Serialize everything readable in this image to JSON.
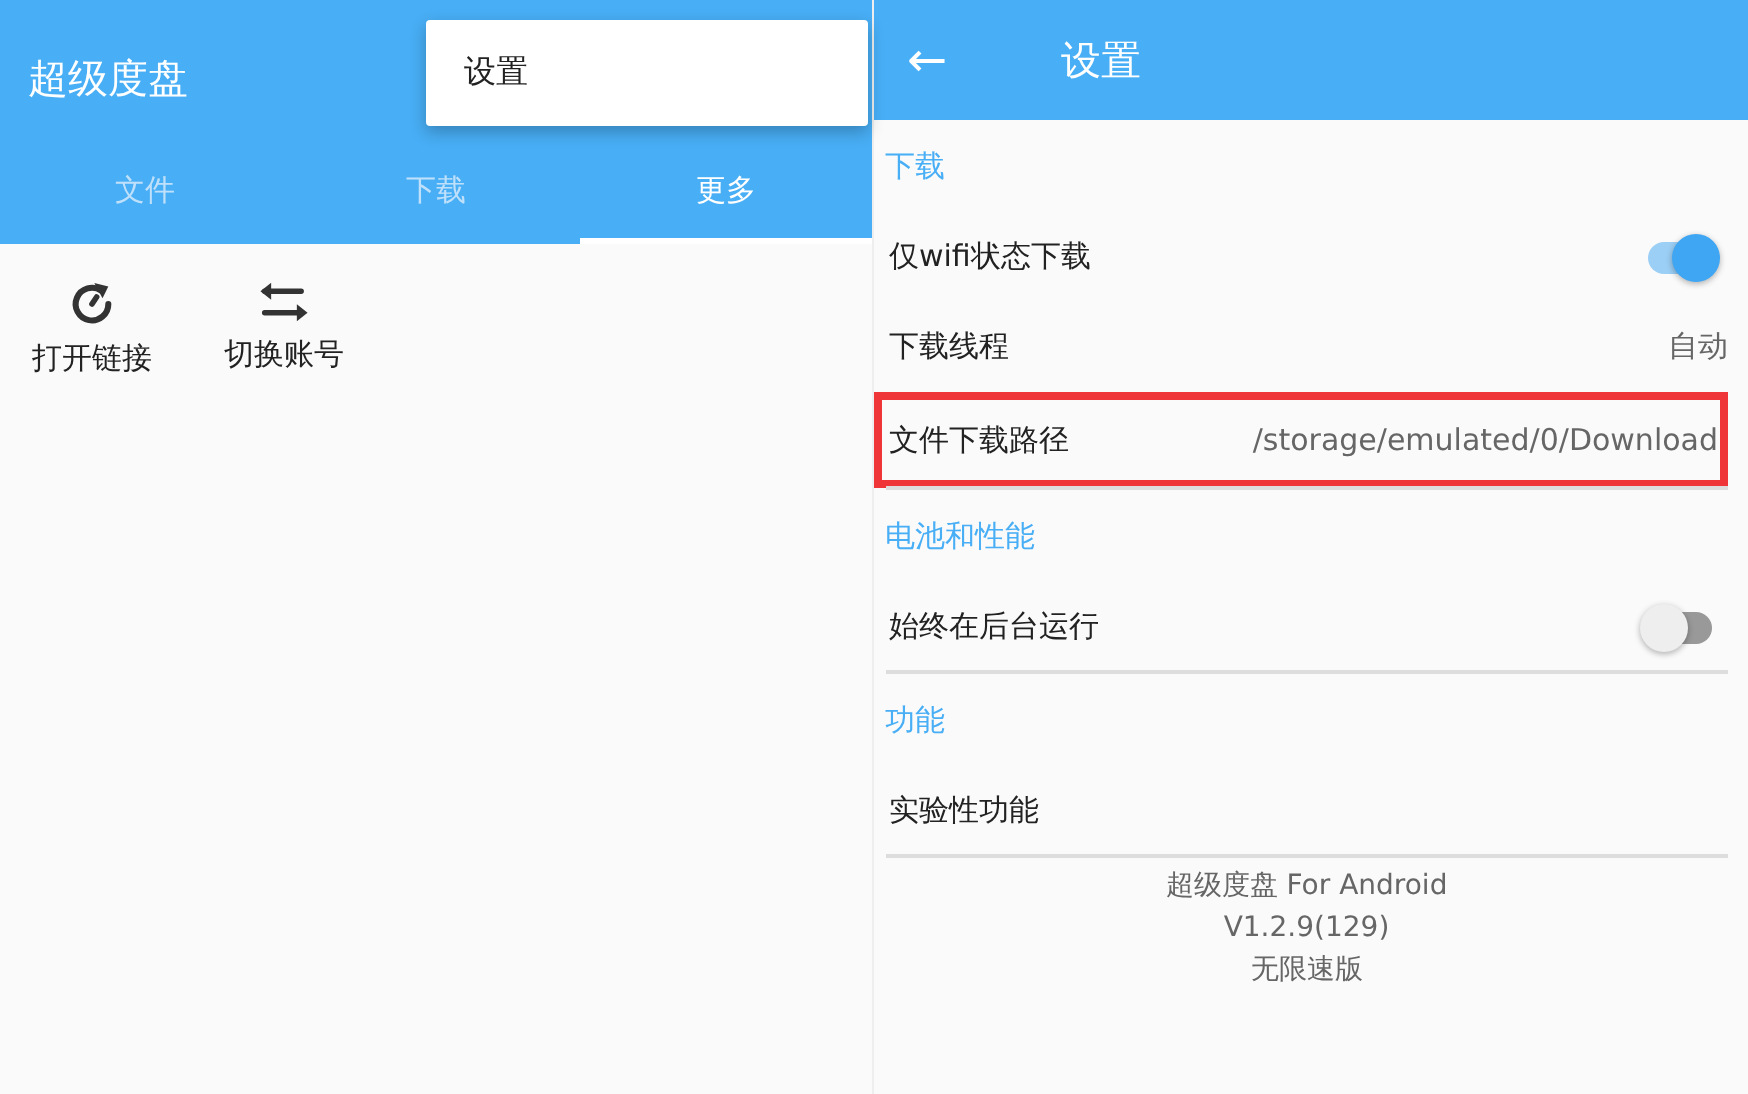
{
  "left": {
    "app_title": "超级度盘",
    "tabs": [
      {
        "label": "文件",
        "selected": false
      },
      {
        "label": "下载",
        "selected": false
      },
      {
        "label": "更多",
        "selected": true
      }
    ],
    "menu": {
      "items": [
        "设置"
      ]
    },
    "actions": [
      {
        "kind": "refresh",
        "label": "打开链接"
      },
      {
        "kind": "swap",
        "label": "切换账号"
      }
    ]
  },
  "right": {
    "back": "←",
    "title": "设置",
    "sections": [
      {
        "title": "下载",
        "rows": [
          {
            "kind": "toggle",
            "label": "仅wifi状态下载",
            "on": true,
            "highlighted": false
          },
          {
            "kind": "value",
            "label": "下载线程",
            "value": "自动",
            "highlighted": false
          },
          {
            "kind": "value",
            "label": "文件下载路径",
            "value": "/storage/emulated/0/Download",
            "highlighted": true
          }
        ]
      },
      {
        "title": "电池和性能",
        "rows": [
          {
            "kind": "toggle",
            "label": "始终在后台运行",
            "on": false,
            "highlighted": false
          }
        ]
      },
      {
        "title": "功能",
        "rows": [
          {
            "kind": "plain",
            "label": "实验性功能",
            "highlighted": false
          }
        ]
      }
    ],
    "footer": [
      "超级度盘 For Android",
      "V1.2.9(129)",
      "无限速版"
    ]
  }
}
